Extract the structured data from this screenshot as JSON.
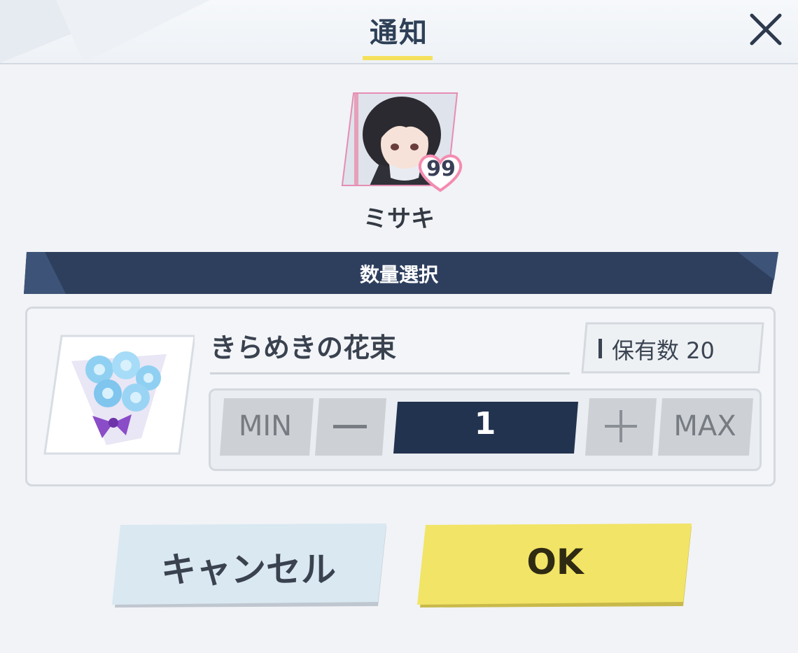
{
  "dialog": {
    "title": "通知",
    "close_icon": "close-icon"
  },
  "character": {
    "name": "ミサキ",
    "affection_level": "99",
    "portrait": "character-portrait"
  },
  "section": {
    "label": "数量選択"
  },
  "item": {
    "name": "きらめきの花束",
    "icon": "bouquet-icon",
    "owned_label": "保有数 20"
  },
  "stepper": {
    "min_label": "MIN",
    "minus_label": "—",
    "quantity": "1",
    "plus_label": "＋",
    "max_label": "MAX"
  },
  "actions": {
    "cancel_label": "キャンセル",
    "ok_label": "OK"
  },
  "colors": {
    "navy": "#2e3f5e",
    "ok_yellow": "#f2e466",
    "cancel_blue": "#d6e6f0",
    "heart_pink": "#f48bb0"
  }
}
